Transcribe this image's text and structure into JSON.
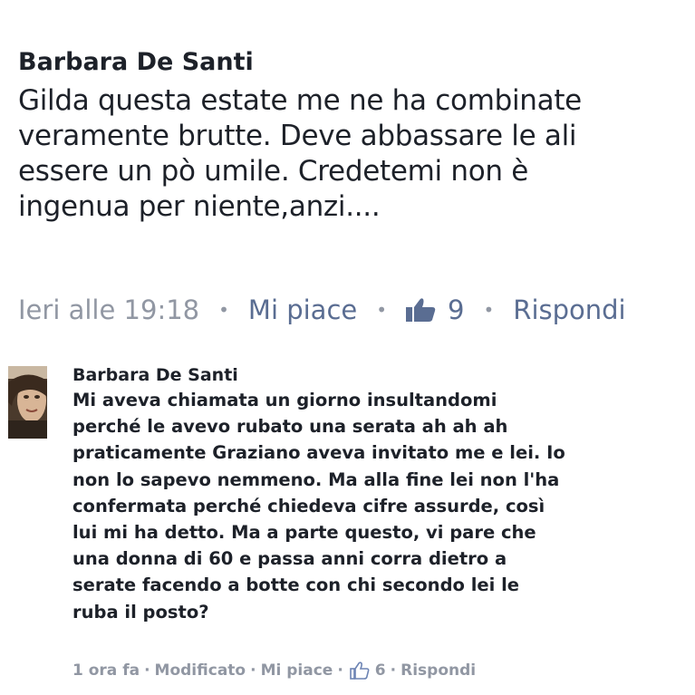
{
  "comment_main": {
    "author": "Barbara De Santi",
    "text_lines": [
      "Gilda questa estate me ne ha combinate",
      "veramente brutte. Deve abbassare le ali",
      "essere un pò umile. Credetemi non è",
      "ingenua per niente,anzi...."
    ],
    "time": "Ieri alle 19:18",
    "like_label": "Mi piace",
    "like_count": "9",
    "reply_label": "Rispondi",
    "separator": "•",
    "like_icon": "thumbs-up-icon"
  },
  "comment_reply": {
    "author": "Barbara De Santi",
    "text_lines": [
      "Mi aveva chiamata un giorno insultandomi",
      "perché le avevo rubato una serata ah ah ah",
      "praticamente Graziano aveva invitato me e lei. Io",
      "non lo sapevo nemmeno. Ma alla fine lei non l'ha",
      "confermata perché chiedeva cifre assurde, così",
      "lui mi ha detto. Ma a parte questo, vi pare che",
      "una donna di 60 e passa anni corra dietro a",
      "serate facendo a botte con chi secondo lei le",
      "ruba il posto?"
    ],
    "time": "1 ora fa",
    "edited_label": "Modificato",
    "like_label": "Mi piace",
    "like_count": "6",
    "reply_label": "Rispondi",
    "separator": "·",
    "like_icon": "thumbs-up-outline-icon",
    "avatar_icon": "user-avatar"
  },
  "colors": {
    "text": "#1d2129",
    "meta": "#9197a3",
    "link": "#5a6d92"
  }
}
